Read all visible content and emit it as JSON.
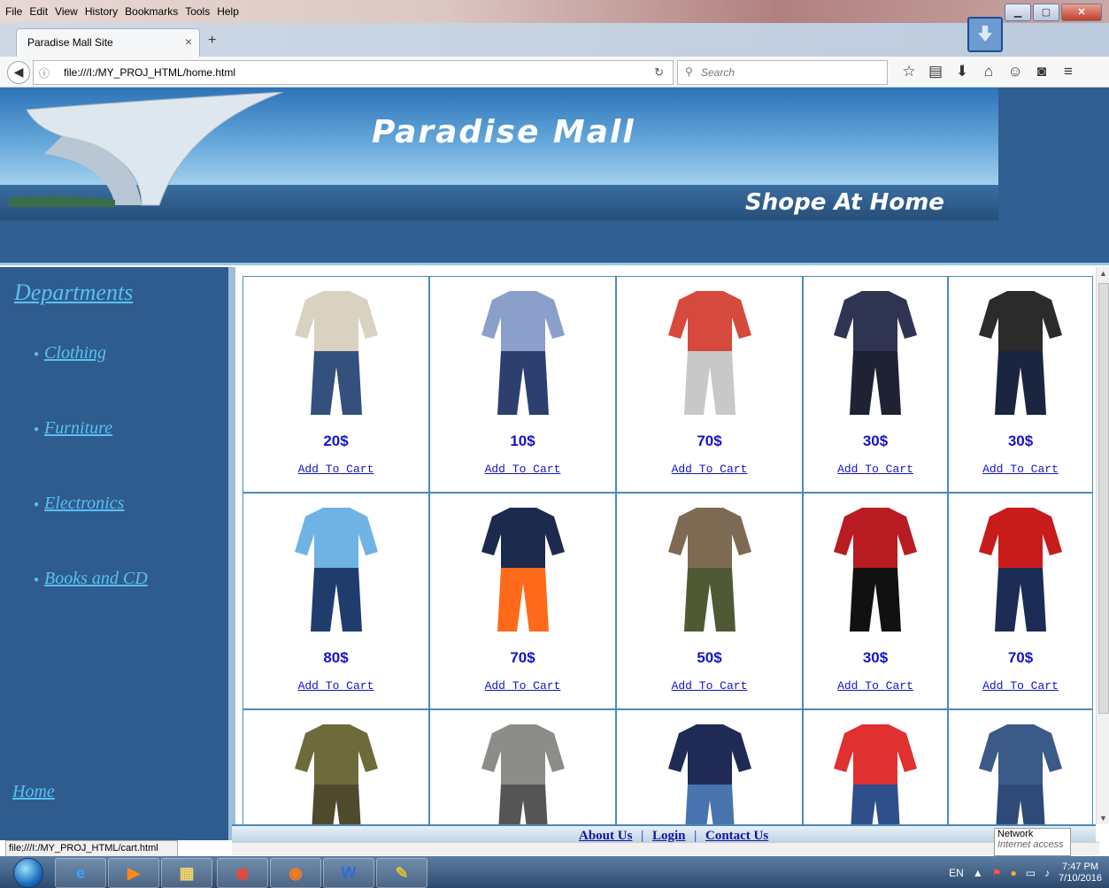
{
  "window": {
    "menu": [
      "File",
      "Edit",
      "View",
      "History",
      "Bookmarks",
      "Tools",
      "Help"
    ],
    "tab_title": "Paradise Mall Site",
    "url": "file:///I:/MY_PROJ_HTML/home.html",
    "search_placeholder": "Search"
  },
  "banner": {
    "title": "Paradise Mall",
    "subtitle": "Shope At Home"
  },
  "sidebar": {
    "heading": "Departments",
    "items": [
      {
        "label": "Clothing"
      },
      {
        "label": "Furniture"
      },
      {
        "label": "Electronics"
      },
      {
        "label": "Books and CD"
      }
    ],
    "home": "Home"
  },
  "products": {
    "cart_label": "Add To Cart",
    "rows": [
      [
        {
          "price": "20$",
          "top": "#d9d2c0",
          "bottom": "#34517e",
          "icon": "baby-romper"
        },
        {
          "price": "10$",
          "top": "#8a9fc9",
          "bottom": "#2c3f6e",
          "icon": "sweater-pants"
        },
        {
          "price": "70$",
          "top": "#d54a3c",
          "bottom": "#c8c8c8",
          "icon": "hoodie-set"
        },
        {
          "price": "30$",
          "top": "#2f3452",
          "bottom": "#1f2233",
          "icon": "hoodie-set"
        },
        {
          "price": "30$",
          "top": "#2b2b2b",
          "bottom": "#1a2540",
          "icon": "shirt-pants"
        }
      ],
      [
        {
          "price": "80$",
          "top": "#6fb3e4",
          "bottom": "#1f3c6d",
          "icon": "jacket-jeans"
        },
        {
          "price": "70$",
          "top": "#1c2a4d",
          "bottom": "#ff6a1a",
          "icon": "tshirt-shorts"
        },
        {
          "price": "50$",
          "top": "#7d6a52",
          "bottom": "#4f5a35",
          "icon": "hoodie-camo"
        },
        {
          "price": "30$",
          "top": "#b81c22",
          "bottom": "#111111",
          "icon": "overalls"
        },
        {
          "price": "70$",
          "top": "#c81c1c",
          "bottom": "#1c2c55",
          "icon": "shirt-pants"
        }
      ],
      [
        {
          "price": "",
          "top": "#6f6a3c",
          "bottom": "#4f4a2c",
          "icon": "camo-pajama"
        },
        {
          "price": "",
          "top": "#8c8c88",
          "bottom": "#555555",
          "icon": "striped-romper"
        },
        {
          "price": "",
          "top": "#1f2a55",
          "bottom": "#4a74b0",
          "icon": "tshirt-pants"
        },
        {
          "price": "",
          "top": "#e03030",
          "bottom": "#2f4f8a",
          "icon": "overalls"
        },
        {
          "price": "",
          "top": "#3c5a88",
          "bottom": "#2f4a78",
          "icon": "overalls"
        }
      ]
    ]
  },
  "footer": {
    "about": "About Us",
    "login": "Login",
    "contact": "Contact Us",
    "sep": "|"
  },
  "status_text": "file:///I:/MY_PROJ_HTML/cart.html",
  "tooltip": {
    "title": "Network",
    "sub": "Internet access"
  },
  "taskbar": {
    "lang": "EN",
    "time": "7:47 PM",
    "date": "7/10/2016"
  },
  "colors": {
    "link_blue": "#1414c8",
    "sidebar_bg": "#2e5c8e",
    "sidebar_link": "#5bc0f0"
  }
}
